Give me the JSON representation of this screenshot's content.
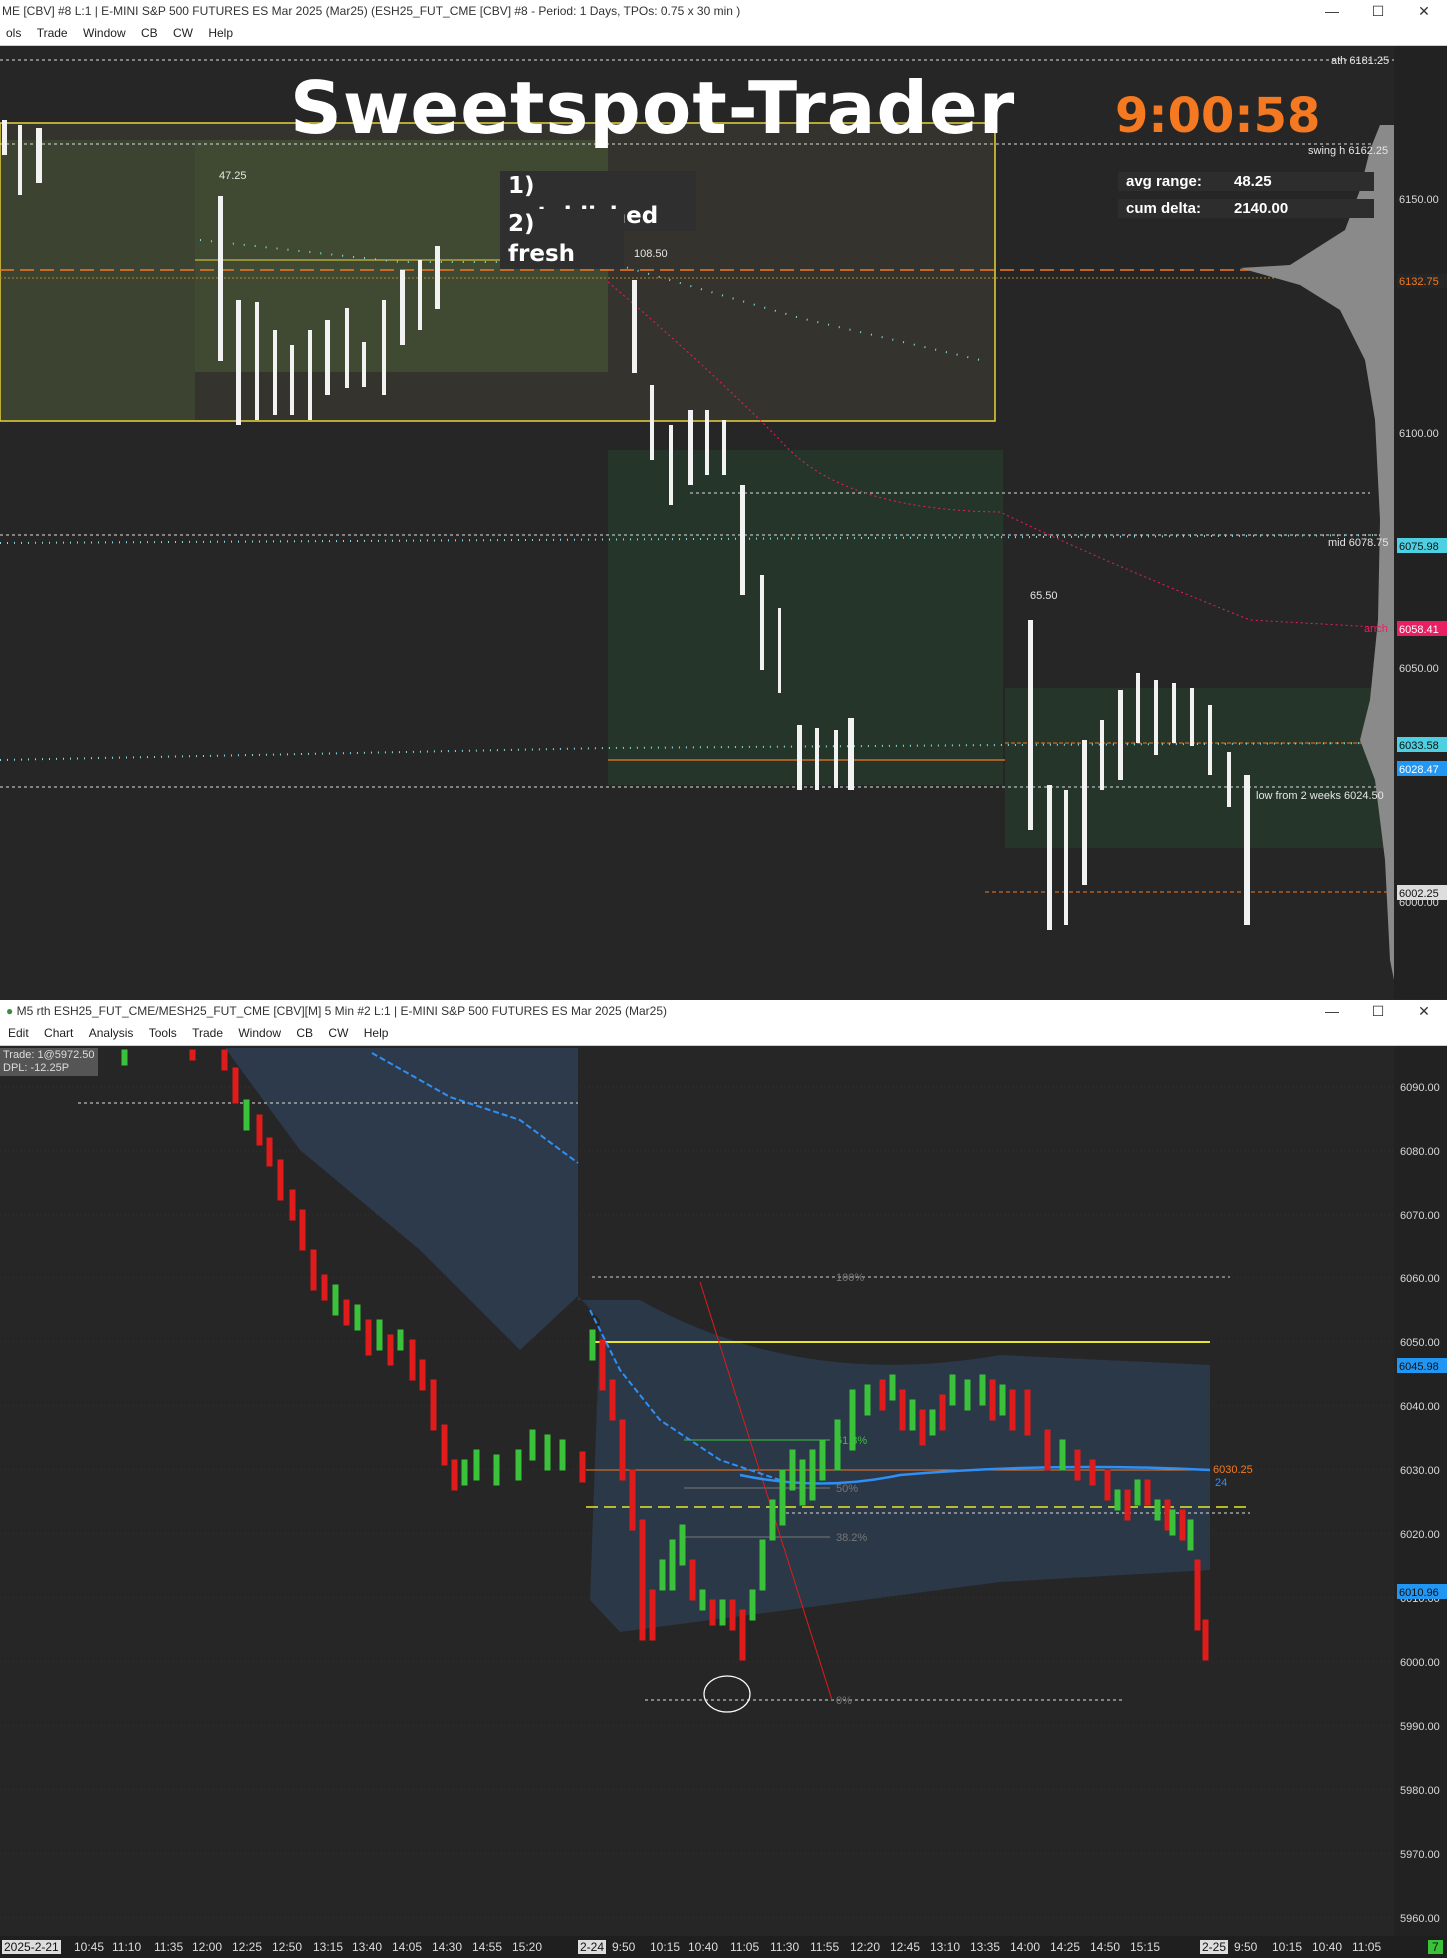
{
  "top_window": {
    "title": "ME [CBV] #8 L:1 | E-MINI S&P 500 FUTURES ES Mar 2025 (Mar25) (ESH25_FUT_CME [CBV] #8 - Period: 1 Days, TPOs: 0.75 x 30 min  )",
    "menu": [
      "ols",
      "Trade",
      "Window",
      "CB",
      "CW",
      "Help"
    ],
    "brand_text": "Sweetspot-Trader",
    "clock": "9:00:58",
    "list": [
      {
        "num": "1)",
        "text": "established"
      },
      {
        "num": "2)",
        "text": "fresh"
      }
    ],
    "stats": [
      {
        "label": "avg range:",
        "value": "48.25"
      },
      {
        "label": "cum delta:",
        "value": "2140.00"
      }
    ],
    "peak_labels": [
      "47.25",
      "108.50",
      "65.50"
    ],
    "level_labels": [
      {
        "text": "ath  6181.25"
      },
      {
        "text": "swing h  6162.25"
      },
      {
        "text": "mid  6078.75"
      },
      {
        "text": "low from 2 weeks  6024.50"
      },
      {
        "text": "anch"
      }
    ],
    "price_axis": [
      "6150.00",
      "6100.00",
      "6050.00",
      "6000.00"
    ],
    "price_badges": [
      {
        "text": "6132.75",
        "color": "#f47920"
      },
      {
        "text": "6075.98",
        "color": "#4dd0e1"
      },
      {
        "text": "6058.41",
        "color": "#e91e63"
      },
      {
        "text": "6033.58",
        "color": "#4dd0e1"
      },
      {
        "text": "6028.47",
        "color": "#2196f3"
      },
      {
        "text": "6002.25",
        "color": "#dddddd"
      }
    ]
  },
  "bottom_window": {
    "title": "M5 rth ESH25_FUT_CME/MESH25_FUT_CME [CBV][M]  5 Min  #2 L:1 | E-MINI S&P 500 FUTURES ES Mar 2025 (Mar25)",
    "menu": [
      "Edit",
      "Chart",
      "Analysis",
      "Tools",
      "Trade",
      "Window",
      "CB",
      "CW",
      "Help"
    ],
    "trade_line1": "Trade: 1@5972.50",
    "trade_line2": "DPL: -12.25P",
    "fib_labels": [
      "100%",
      "61.8%",
      "50%",
      "38.2%",
      "0%"
    ],
    "right_labels": [
      "6030.25",
      "24"
    ],
    "price_axis": [
      "6090.00",
      "6080.00",
      "6070.00",
      "6060.00",
      "6050.00",
      "6040.00",
      "6030.00",
      "6020.00",
      "6010.00",
      "6000.00",
      "5990.00",
      "5980.00",
      "5970.00",
      "5960.00"
    ],
    "price_badges": [
      {
        "text": "6045.98",
        "color": "#2196f3"
      },
      {
        "text": "6010.96",
        "color": "#2196f3"
      }
    ],
    "corner_badge": "7",
    "time_axis": [
      "2025-2-21",
      "10:45",
      "11:10",
      "11:35",
      "12:00",
      "12:25",
      "12:50",
      "13:15",
      "13:40",
      "14:05",
      "14:30",
      "14:55",
      "15:20",
      "2-24",
      "9:50",
      "10:15",
      "10:40",
      "11:05",
      "11:30",
      "11:55",
      "12:20",
      "12:45",
      "13:10",
      "13:35",
      "14:00",
      "14:25",
      "14:50",
      "15:15",
      "2-25",
      "9:50",
      "10:15",
      "10:40",
      "11:05"
    ]
  }
}
